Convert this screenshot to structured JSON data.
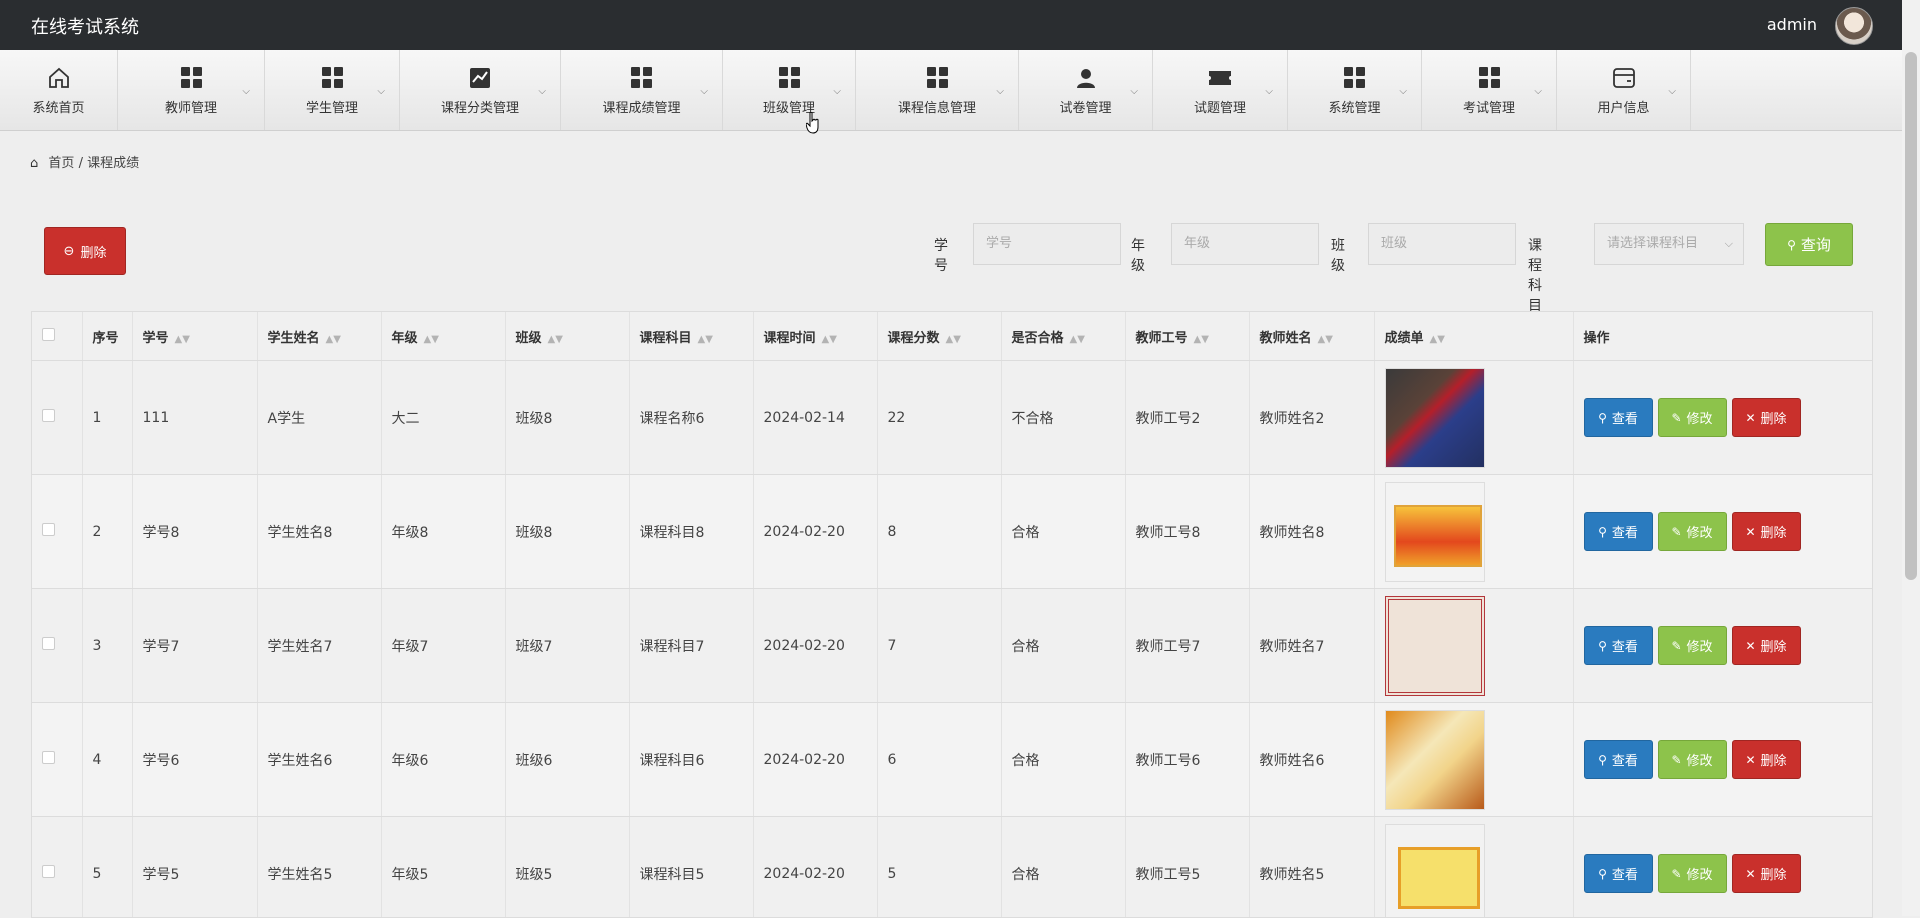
{
  "app": {
    "title": "在线考试系统",
    "user": "admin"
  },
  "nav": {
    "items": [
      {
        "label": "系统首页",
        "icon": "home-icon",
        "dropdown": false
      },
      {
        "label": "教师管理",
        "icon": "grid-icon",
        "dropdown": true
      },
      {
        "label": "学生管理",
        "icon": "grid-icon",
        "dropdown": true
      },
      {
        "label": "课程分类管理",
        "icon": "chart-icon",
        "dropdown": true
      },
      {
        "label": "课程成绩管理",
        "icon": "grid-icon",
        "dropdown": true
      },
      {
        "label": "班级管理",
        "icon": "grid-icon",
        "dropdown": true
      },
      {
        "label": "课程信息管理",
        "icon": "grid-icon",
        "dropdown": true
      },
      {
        "label": "试卷管理",
        "icon": "user-icon",
        "dropdown": true
      },
      {
        "label": "试题管理",
        "icon": "ticket-icon",
        "dropdown": true
      },
      {
        "label": "系统管理",
        "icon": "grid-icon",
        "dropdown": true
      },
      {
        "label": "考试管理",
        "icon": "grid-icon",
        "dropdown": true
      },
      {
        "label": "用户信息",
        "icon": "card-icon",
        "dropdown": true
      }
    ]
  },
  "breadcrumb": {
    "home": "首页",
    "separator": "/",
    "current": "课程成绩"
  },
  "toolbar": {
    "delete_label": "删除"
  },
  "filters": {
    "student_id": {
      "label": "学号",
      "placeholder": "学号"
    },
    "grade": {
      "label": "年级",
      "placeholder": "年级"
    },
    "class": {
      "label": "班级",
      "placeholder": "班级"
    },
    "subject": {
      "label": "课程科目",
      "placeholder": "请选择课程科目"
    },
    "query_label": "查询"
  },
  "table": {
    "headers": [
      "序号",
      "学号",
      "学生姓名",
      "年级",
      "班级",
      "课程科目",
      "课程时间",
      "课程分数",
      "是否合格",
      "教师工号",
      "教师姓名",
      "成绩单",
      "操作"
    ],
    "actions": {
      "view": "查看",
      "edit": "修改",
      "delete": "删除"
    },
    "rows": [
      [
        "1",
        "111",
        "A学生",
        "大二",
        "班级8",
        "课程名称6",
        "2024-02-14",
        "22",
        "不合格",
        "教师工号2",
        "教师姓名2"
      ],
      [
        "2",
        "学号8",
        "学生姓名8",
        "年级8",
        "班级8",
        "课程科目8",
        "2024-02-20",
        "8",
        "合格",
        "教师工号8",
        "教师姓名8"
      ],
      [
        "3",
        "学号7",
        "学生姓名7",
        "年级7",
        "班级7",
        "课程科目7",
        "2024-02-20",
        "7",
        "合格",
        "教师工号7",
        "教师姓名7"
      ],
      [
        "4",
        "学号6",
        "学生姓名6",
        "年级6",
        "班级6",
        "课程科目6",
        "2024-02-20",
        "6",
        "合格",
        "教师工号6",
        "教师姓名6"
      ],
      [
        "5",
        "学号5",
        "学生姓名5",
        "年级5",
        "班级5",
        "课程科目5",
        "2024-02-20",
        "5",
        "合格",
        "教师工号5",
        "教师姓名5"
      ]
    ]
  },
  "colors": {
    "topbar": "#2a2d30",
    "danger": "#c9302c",
    "primary": "#2a7bbf",
    "success": "#8dc34b"
  }
}
